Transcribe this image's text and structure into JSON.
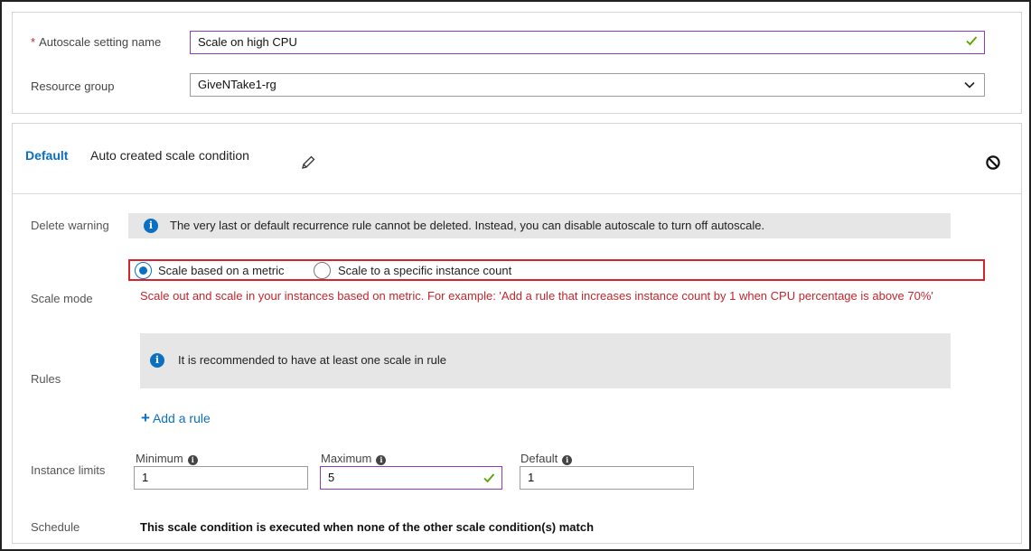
{
  "settings": {
    "name_label": "Autoscale setting name",
    "name_required_marker": "*",
    "name_value": "Scale on high CPU",
    "resource_group_label": "Resource group",
    "resource_group_value": "GiveNTake1-rg"
  },
  "condition": {
    "default_label": "Default",
    "title": "Auto created scale condition",
    "delete_warning_label": "Delete warning",
    "delete_warning_text": "The very last or default recurrence rule cannot be deleted. Instead, you can disable autoscale to turn off autoscale.",
    "scale_mode_label": "Scale mode",
    "scale_mode_options": [
      "Scale based on a metric",
      "Scale to a specific instance count"
    ],
    "scale_mode_selected": "Scale based on a metric",
    "scale_mode_note": "Scale out and scale in your instances based on metric. For example: 'Add a rule that increases instance count by 1 when CPU percentage is above 70%'",
    "rules_label": "Rules",
    "rules_info": "It is recommended to have at least one scale in rule",
    "add_rule_label": "Add a rule",
    "instance_limits_label": "Instance limits",
    "minimum_label": "Minimum",
    "minimum_value": "1",
    "maximum_label": "Maximum",
    "maximum_value": "5",
    "default_count_label": "Default",
    "default_count_value": "1",
    "schedule_label": "Schedule",
    "schedule_text": "This scale condition is executed when none of the other scale condition(s) match"
  },
  "colors": {
    "accent_blue": "#0b6fc2",
    "error_red": "#c4262e",
    "highlight_red": "#d6242e",
    "valid_green": "#57a300",
    "focus_purple": "#8a3db6"
  }
}
